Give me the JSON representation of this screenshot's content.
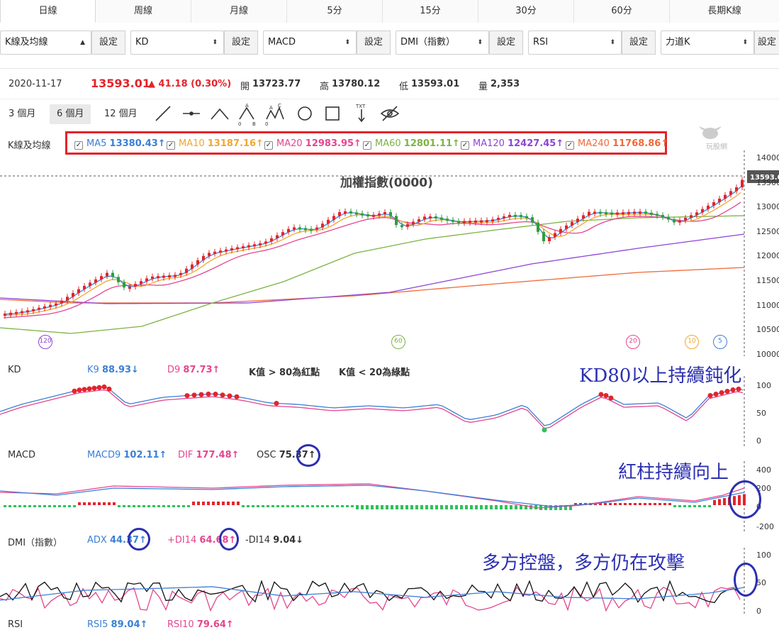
{
  "tabs": [
    "日線",
    "周線",
    "月線",
    "5分",
    "15分",
    "30分",
    "60分",
    "長期K線"
  ],
  "indicators": [
    {
      "value": "K線及均線",
      "btn": "設定"
    },
    {
      "value": "KD",
      "btn": "設定"
    },
    {
      "value": "MACD",
      "btn": "設定"
    },
    {
      "value": "DMI（指數）",
      "btn": "設定"
    },
    {
      "value": "RSI",
      "btn": "設定"
    },
    {
      "value": "力道K",
      "btn": "設定"
    }
  ],
  "quote": {
    "date": "2020-11-17",
    "price": "13593.01",
    "change": "▲ 41.18 (0.30%)",
    "open_label": "開",
    "open": "13723.77",
    "high_label": "高",
    "high": "13780.12",
    "low_label": "低",
    "low": "13593.01",
    "vol_label": "量",
    "vol": "2,353"
  },
  "ranges": [
    "3 個月",
    "6 個月",
    "12 個月"
  ],
  "main_panel": {
    "label": "K線及均線",
    "title": "加權指數(0000)",
    "last_price": "13593.0",
    "watermark": "玩股網"
  },
  "ma": [
    {
      "name": "MA5",
      "value": "13380.43↑",
      "color": "#3b7fd6"
    },
    {
      "name": "MA10",
      "value": "13187.16↑",
      "color": "#f0a631"
    },
    {
      "name": "MA20",
      "value": "12983.95↑",
      "color": "#e4468f"
    },
    {
      "name": "MA60",
      "value": "12801.11↑",
      "color": "#7cb342"
    },
    {
      "name": "MA120",
      "value": "12427.45↑",
      "color": "#8e44d6"
    },
    {
      "name": "MA240",
      "value": "11768.86↑",
      "color": "#f06a3a"
    }
  ],
  "y_axis": [
    "14000",
    "13500",
    "13000",
    "12500",
    "12000",
    "11500",
    "11000",
    "10500",
    "10000"
  ],
  "period_markers": [
    {
      "text": "120",
      "color": "#8e44d6"
    },
    {
      "text": "60",
      "color": "#7cb342"
    },
    {
      "text": "20",
      "color": "#e4468f"
    },
    {
      "text": "10",
      "color": "#f0a631"
    },
    {
      "text": "5",
      "color": "#3b7fd6"
    }
  ],
  "kd": {
    "label": "KD",
    "k": "K9",
    "k_val": "88.93↓",
    "d": "D9",
    "d_val": "87.73↑",
    "note1": "K值 > 80為紅點",
    "note2": "K值 < 20為綠點",
    "axis": [
      "100",
      "50",
      "0"
    ]
  },
  "macd": {
    "label": "MACD",
    "m9": "MACD9",
    "m9_val": "102.11↑",
    "dif": "DIF",
    "dif_val": "177.48↑",
    "osc": "OSC",
    "osc_val": "75.37↑",
    "axis": [
      "400",
      "200",
      "0",
      "-200"
    ]
  },
  "dmi": {
    "label": "DMI（指數）",
    "adx": "ADX",
    "adx_val": "44.37↑",
    "pdi": "+DI14",
    "pdi_val": "64.68↑",
    "mdi": "-DI14",
    "mdi_val": "9.04↓",
    "axis": [
      "100",
      "50",
      "0"
    ]
  },
  "rsi": {
    "label": "RSI",
    "r5": "RSI5",
    "r5_val": "89.04↑",
    "r10": "RSI10",
    "r10_val": "79.64↑"
  },
  "annotations": {
    "kd": "KD80以上持續鈍化",
    "macd": "紅柱持續向上",
    "dmi": "多方控盤，多方仍在攻擊"
  }
}
